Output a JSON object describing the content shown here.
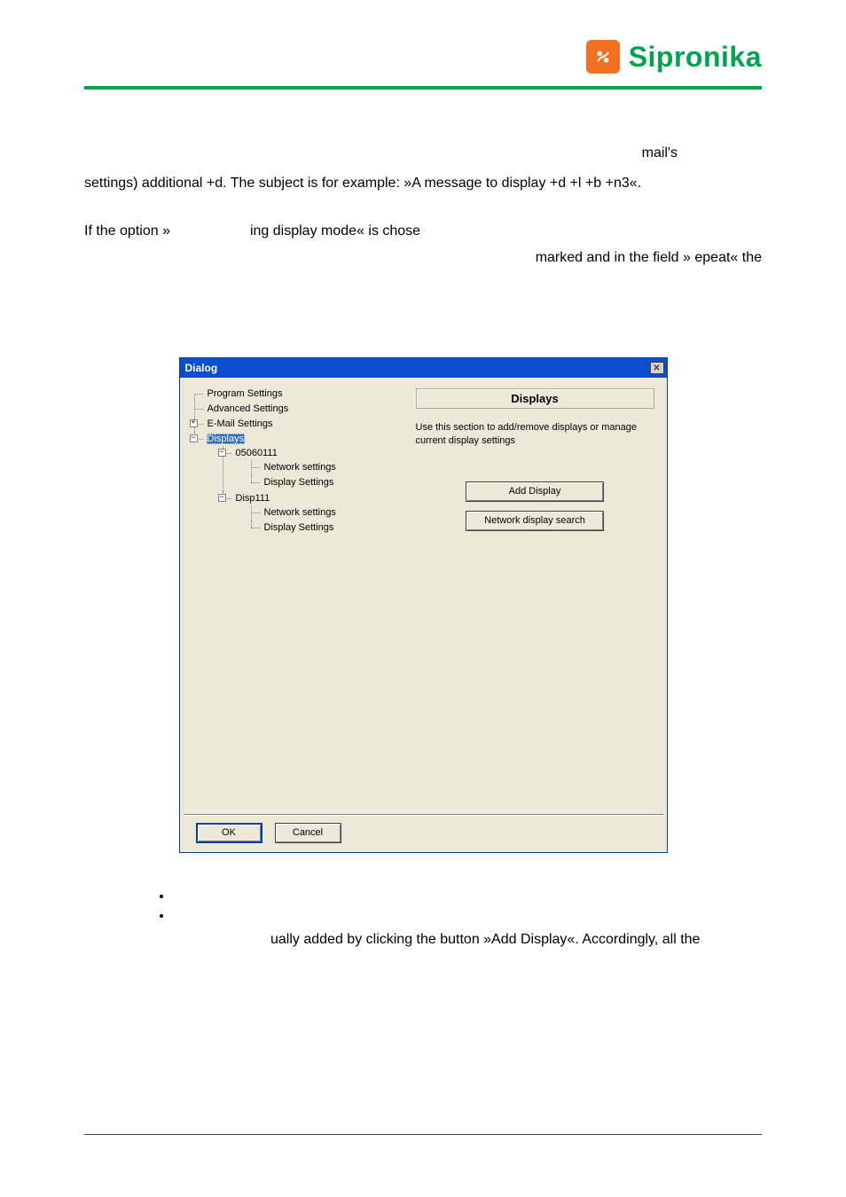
{
  "brand": {
    "name": "Sipronika"
  },
  "doc": {
    "frag1": "mail's",
    "frag2": "settings) additional +d. The subject is for example: »A message to display +d +l +b +n3«.",
    "frag3a": "If the option »",
    "frag3b": "ing display mode« is chose",
    "frag4": "marked  and  in  the  field  » epeat«  the",
    "frag5": "ually  added  by  clicking  the  button  »Add  Display«.  Accordingly,  all  the"
  },
  "dialog": {
    "title": "Dialog",
    "tree": {
      "program_settings": "Program Settings",
      "advanced_settings": "Advanced Settings",
      "email_settings": "E-Mail Settings",
      "displays": "Displays",
      "d1": "05060111",
      "d1_net": "Network settings",
      "d1_disp": "Display Settings",
      "d2": "Disp111",
      "d2_net": "Network settings",
      "d2_disp": "Display Settings"
    },
    "right": {
      "heading": "Displays",
      "desc": "Use this section to add/remove displays or manage current display settings",
      "btn_add": "Add Display",
      "btn_search": "Network display search"
    },
    "footer": {
      "ok": "OK",
      "cancel": "Cancel"
    }
  }
}
